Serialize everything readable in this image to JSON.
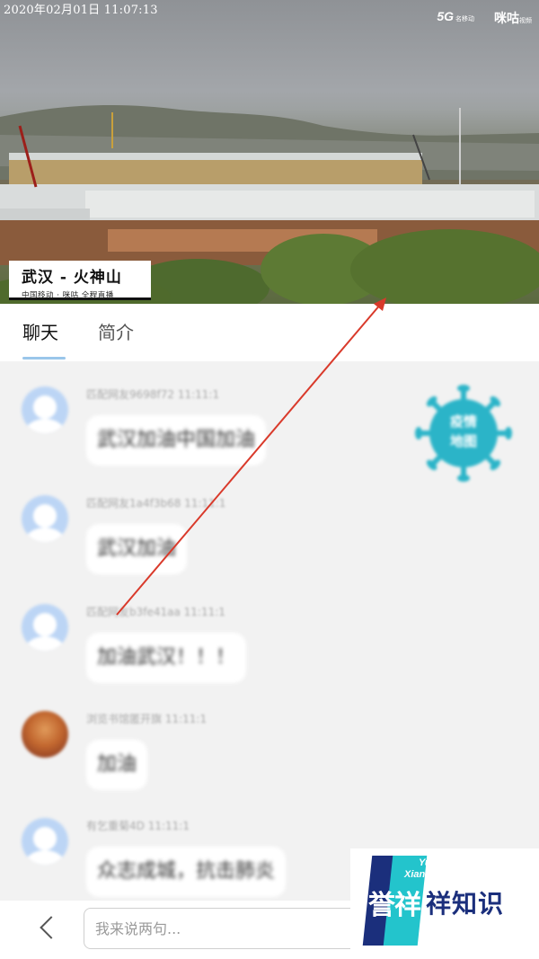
{
  "video": {
    "timestamp": "2020年02月01日  11:07:13",
    "brand_5g": "5G",
    "brand_5g_sub": "名移动",
    "brand_migu": "咪咕",
    "brand_migu_sub": "视频",
    "caption_title": "武汉 - 火神山",
    "caption_sub": "中国移动 · 咪咕  全程直播"
  },
  "tabs": [
    {
      "label": "聊天",
      "active": true
    },
    {
      "label": "简介",
      "active": false
    }
  ],
  "messages": [
    {
      "meta": "匹配网友9698f72  11:11:1",
      "text": "武汉加油中国加油"
    },
    {
      "meta": "匹配网友1a4f3b68  11:11:1",
      "text": "武汉加油"
    },
    {
      "meta": "匹配网友b3fe41aa  11:11:1",
      "text": "加油武汉！！！"
    },
    {
      "meta": "浏览书馆匿开旗  11:11:1",
      "text": "加油"
    },
    {
      "meta": "有乞重菊4D  11:11:1",
      "text": "众志成城，抗击肺炎"
    }
  ],
  "badge": {
    "line1": "疫情",
    "line2": "地图"
  },
  "bottom": {
    "input_placeholder": "我来说两句..."
  },
  "watermark": {
    "en1": "YuXiang",
    "en2": "XiangZhiShi",
    "cn_a": "誉祥",
    "cn_b": "祥知识"
  },
  "colors": {
    "accent_underline": "#9ac6ea",
    "arrow": "#d93a2b",
    "badge": "#2bb4c8"
  }
}
